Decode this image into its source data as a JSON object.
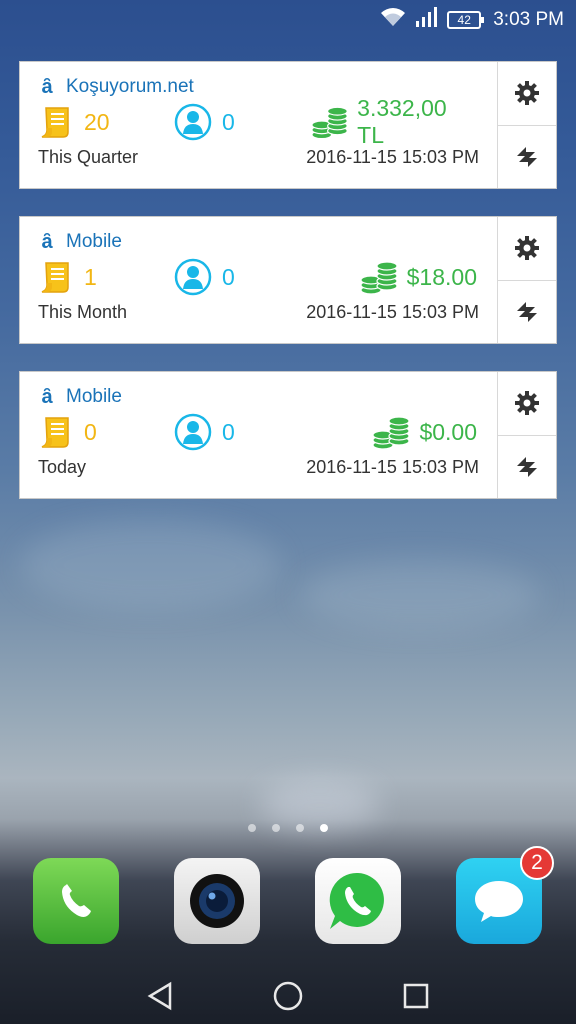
{
  "status_bar": {
    "battery": "42",
    "time": "3:03 PM"
  },
  "widgets": [
    {
      "title": "Koşuyorum.net",
      "orders": "20",
      "users": "0",
      "amount": "3.332,00 TL",
      "period": "This Quarter",
      "timestamp": "2016-11-15 15:03 PM"
    },
    {
      "title": "Mobile",
      "orders": "1",
      "users": "0",
      "amount": "$18.00",
      "period": "This Month",
      "timestamp": "2016-11-15 15:03 PM"
    },
    {
      "title": "Mobile",
      "orders": "0",
      "users": "0",
      "amount": "$0.00",
      "period": "Today",
      "timestamp": "2016-11-15 15:03 PM"
    }
  ],
  "widget_icons": {
    "logo": "store-logo-icon",
    "orders": "receipt-icon",
    "users": "user-icon",
    "amount": "coins-icon",
    "settings": "gear-icon",
    "refresh": "refresh-icon"
  },
  "dock": {
    "apps": [
      "phone",
      "camera",
      "whatsapp",
      "messages"
    ],
    "messages_badge": "2"
  },
  "home_pages": {
    "count": 4,
    "active": 4
  },
  "colors": {
    "title": "#1a73b8",
    "orders": "#f2b614",
    "users": "#19b7e8",
    "amount": "#3cb54a"
  }
}
